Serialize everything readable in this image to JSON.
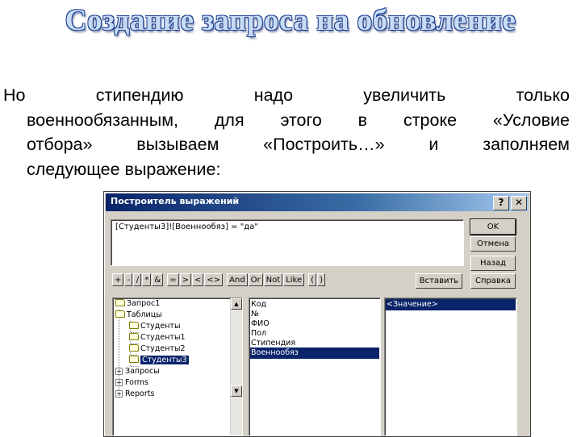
{
  "slide": {
    "title": "Создание запроса на обновление",
    "paragraph": {
      "line1_words": [
        "Но",
        "стипендию",
        "надо",
        "увеличить",
        "только"
      ],
      "line2_words": [
        "военнообязанным,",
        "для",
        "этого",
        "в",
        "строке",
        "«Условие"
      ],
      "line3_words": [
        "отбора»",
        "вызываем",
        "«Построить…»",
        "и",
        "заполняем"
      ],
      "line4": "следующее выражение:"
    }
  },
  "dialog": {
    "title": "Построитель выражений",
    "help_glyph": "?",
    "close_glyph": "✕",
    "expression": "[Студенты3]![Военнообяз] = \"да\"",
    "buttons": {
      "ok": "OK",
      "cancel": "Отмена",
      "back": "Назад",
      "paste": "Вставить",
      "help": "Справка"
    },
    "operators": [
      "+",
      "-",
      "/",
      "*",
      "&",
      "=",
      ">",
      "<",
      "<>",
      "And",
      "Or",
      "Not",
      "Like",
      "(",
      ")"
    ],
    "tree": [
      {
        "label": "Запрос1",
        "icon": "folder-icon"
      },
      {
        "label": "Таблицы",
        "icon": "folder-open-icon"
      },
      {
        "label": "Студенты",
        "icon": "folder-icon"
      },
      {
        "label": "Студенты1",
        "icon": "folder-icon"
      },
      {
        "label": "Студенты2",
        "icon": "folder-icon"
      },
      {
        "label": "Студенты3",
        "icon": "folder-icon"
      },
      {
        "label": "Запросы",
        "icon": "plus-box-icon"
      },
      {
        "label": "Forms",
        "icon": "plus-box-icon"
      },
      {
        "label": "Reports",
        "icon": "plus-box-icon"
      }
    ],
    "fields": [
      "Код",
      "№",
      "ФИО",
      "Пол",
      "Стипендия",
      "Военнообяз"
    ],
    "values": [
      "<Значение>"
    ],
    "colors": {
      "selection": "#0a246a",
      "titlebar_start": "#0a246a",
      "titlebar_end": "#a6caf0",
      "face": "#d4d0c8"
    }
  }
}
